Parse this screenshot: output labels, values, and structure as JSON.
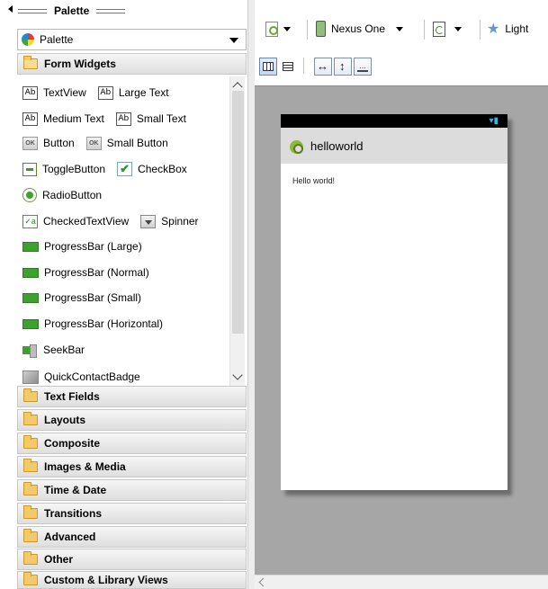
{
  "palette_view": {
    "title": "Palette",
    "select_value": "Palette"
  },
  "sections": {
    "form_widgets": "Form Widgets",
    "collapsed": [
      "Text Fields",
      "Layouts",
      "Composite",
      "Images & Media",
      "Time & Date",
      "Transitions",
      "Advanced",
      "Other",
      "Custom & Library Views"
    ]
  },
  "widgets": {
    "textview": "TextView",
    "large_text": "Large Text",
    "medium_text": "Medium Text",
    "small_text": "Small Text",
    "button": "Button",
    "small_button": "Small Button",
    "togglebutton": "ToggleButton",
    "checkbox": "CheckBox",
    "radiobutton": "RadioButton",
    "checkedtextview": "CheckedTextView",
    "spinner": "Spinner",
    "progress_large": "ProgressBar (Large)",
    "progress_normal": "ProgressBar (Normal)",
    "progress_small": "ProgressBar (Small)",
    "progress_horizontal": "ProgressBar (Horizontal)",
    "seekbar": "SeekBar",
    "quickcontactbadge": "QuickContactBadge",
    "icon_text": {
      "ab": "Ab",
      "ok": "OK",
      "ctv": "✓a",
      "check": "✔"
    }
  },
  "toolbar": {
    "device": "Nexus One",
    "theme": "Light",
    "star": "★",
    "fit_h": "↔",
    "fit_v": "↕",
    "fit_b": "..."
  },
  "preview": {
    "app_title": "helloworld",
    "body_text": "Hello world!",
    "status_glyph": "▾▮"
  }
}
